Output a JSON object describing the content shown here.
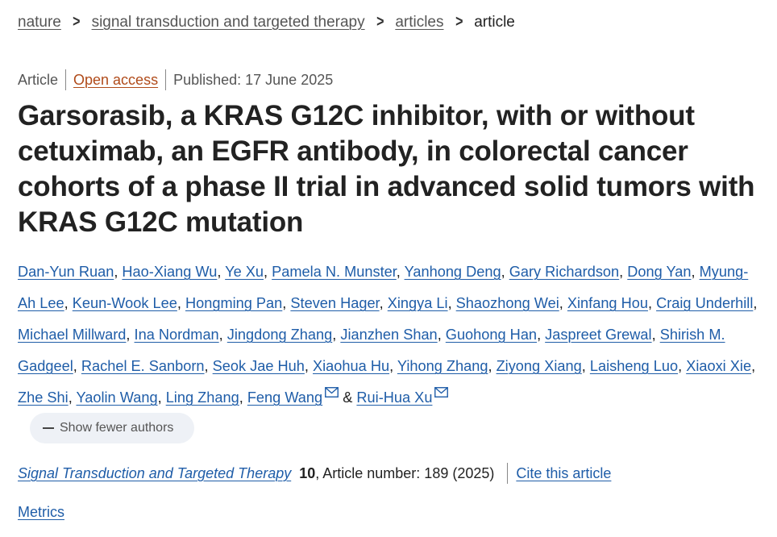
{
  "breadcrumb": {
    "items": [
      "nature",
      "signal transduction and targeted therapy",
      "articles"
    ],
    "current": "article",
    "separator": ">"
  },
  "meta": {
    "type": "Article",
    "access": "Open access",
    "published": "Published: 17 June 2025"
  },
  "title": "Garsorasib, a KRAS G12C inhibitor, with or without cetuximab, an EGFR antibody, in colorectal cancer cohorts of a phase II trial in advanced solid tumors with KRAS G12C mutation",
  "authors": {
    "list": [
      "Dan-Yun Ruan",
      "Hao-Xiang Wu",
      "Ye Xu",
      "Pamela N. Munster",
      "Yanhong Deng",
      "Gary Richardson",
      "Dong Yan",
      "Myung-Ah Lee",
      "Keun-Wook Lee",
      "Hongming Pan",
      "Steven Hager",
      "Xingya Li",
      "Shaozhong Wei",
      "Xinfang Hou",
      "Craig Underhill",
      "Michael Millward",
      "Ina Nordman",
      "Jingdong Zhang",
      "Jianzhen Shan",
      "Guohong Han",
      "Jaspreet Grewal",
      "Shirish M. Gadgeel",
      "Rachel E. Sanborn",
      "Seok Jae Huh",
      "Xiaohua Hu",
      "Yihong Zhang",
      "Ziyong Xiang",
      "Laisheng Luo",
      "Xiaoxi Xie",
      "Zhe Shi",
      "Yaolin Wang",
      "Ling Zhang",
      "Feng Wang",
      "Rui-Hua Xu"
    ],
    "corresponding": [
      "Feng Wang",
      "Rui-Hua Xu"
    ],
    "joiner": "&",
    "show_fewer_label": "Show fewer authors"
  },
  "citation": {
    "journal": "Signal Transduction and Targeted Therapy",
    "volume": "10",
    "article_info": ", Article number: 189 (2025)",
    "cite_label": "Cite this article"
  },
  "metrics_label": "Metrics",
  "colors": {
    "link": "#1f5da8",
    "open_access": "#b04b1a",
    "text": "#222222",
    "muted": "#555555",
    "button_bg": "#eef1f6"
  },
  "icons": {
    "breadcrumb_separator": "chevron-right-icon",
    "corresponding_author": "mail-icon",
    "show_fewer": "minus-icon"
  }
}
